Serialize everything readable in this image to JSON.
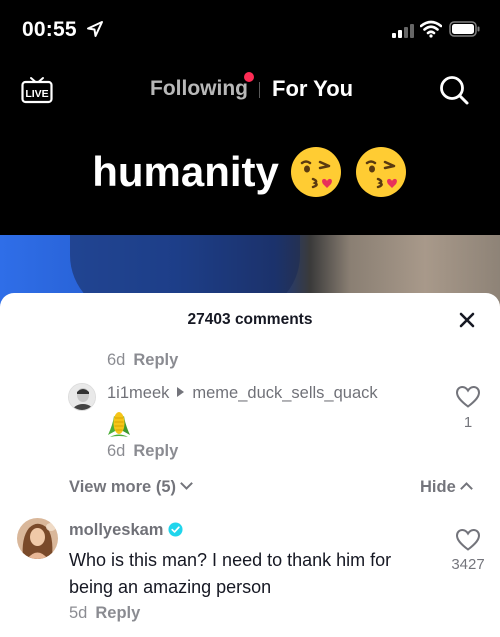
{
  "status_bar": {
    "time": "00:55"
  },
  "top_nav": {
    "tabs": [
      {
        "label": "Following",
        "active": false,
        "has_dot": true
      },
      {
        "label": "For You",
        "active": true
      }
    ]
  },
  "video": {
    "caption": "humanity"
  },
  "comments_sheet": {
    "title": "27403 comments",
    "previous_comment": {
      "time": "6d",
      "reply_label": "Reply"
    },
    "reply": {
      "username": "1i1meek",
      "reply_to": "meme_duck_sells_quack",
      "content_emoji": "corn-icon",
      "time": "6d",
      "reply_label": "Reply",
      "likes": "1"
    },
    "view_more_label": "View more (5)",
    "hide_label": "Hide",
    "comment": {
      "username": "mollyeskam",
      "verified": true,
      "text": "Who is this man? I need to thank him for being an amazing person",
      "time": "5d",
      "reply_label": "Reply",
      "likes": "3427"
    }
  },
  "colors": {
    "notification_dot": "#fe2c55",
    "verified_badge": "#20d5ec",
    "sheet_background": "#ffffff"
  }
}
